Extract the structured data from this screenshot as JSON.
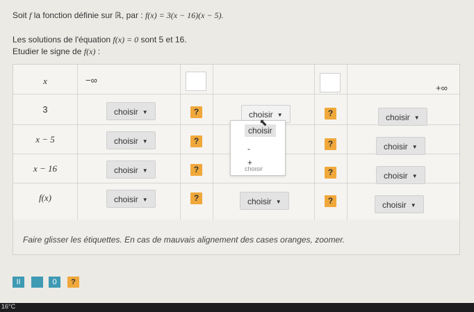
{
  "intro": {
    "line1_text": "Soit ",
    "line1_f": "f",
    "line1_mid": " la fonction définie sur ℝ, par : ",
    "line1_formula": "f(x) = 3(x − 16)(x − 5).",
    "line2_text": "Les solutions de l'équation ",
    "line2_formula": "f(x) = 0",
    "line2_end": " sont 5 et 16.",
    "line3_text": "Etudier le signe de ",
    "line3_formula": "f(x)",
    "line3_end": " :"
  },
  "table": {
    "header_x": "x",
    "minus_inf": "−∞",
    "plus_inf": "+∞",
    "row_labels": [
      "3",
      "x − 5",
      "x − 16",
      "f(x)"
    ],
    "select_label": "choisir",
    "q_label": "?"
  },
  "dropdown": {
    "options": [
      "choisir",
      "-",
      "+"
    ],
    "hidden_text": "choisir"
  },
  "hint": "Faire glisser les étiquettes. En cas de mauvais alignement des cases oranges, zoomer.",
  "tools": {
    "pause": "II",
    "zero": "0",
    "help": "?"
  },
  "taskbar": {
    "temp": "16°C"
  },
  "colors": {
    "orange": "#f0a83a",
    "teal": "#3f9ab4",
    "select_bg": "#e3e3e3"
  }
}
